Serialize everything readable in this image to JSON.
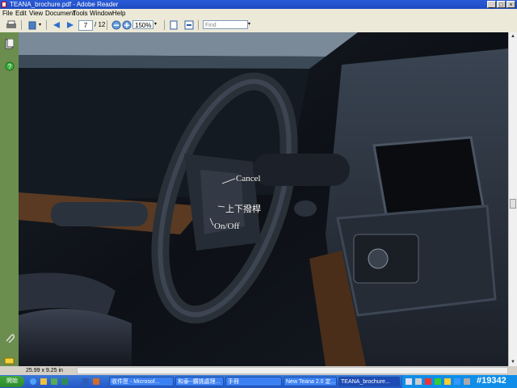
{
  "window": {
    "title": "TEANA_brochure.pdf - Adobe Reader"
  },
  "menu": [
    "File",
    "Edit",
    "View",
    "Document",
    "Tools",
    "Window",
    "Help"
  ],
  "toolbar": {
    "page_current": "7",
    "page_total": "/ 12",
    "zoom": "150%",
    "find_placeholder": "Find"
  },
  "status": {
    "page_size": "25.99 x 9.25 in"
  },
  "photo_labels": {
    "cancel": "Cancel",
    "updown": "上下撥桿",
    "onoff": "On/Off"
  },
  "taskbar": {
    "start": "開始",
    "tasks": [
      "收件匣 - Microsof...",
      "和泰--鑽挑處理...",
      "手冊",
      "New Teana 2.0 定...",
      "TEANA_brochure..."
    ]
  },
  "watermark": "#19342",
  "colors": {
    "titlebar": "#1f4bc2",
    "sidebar": "#6b8e4e",
    "taskbar": "#2457c5"
  }
}
